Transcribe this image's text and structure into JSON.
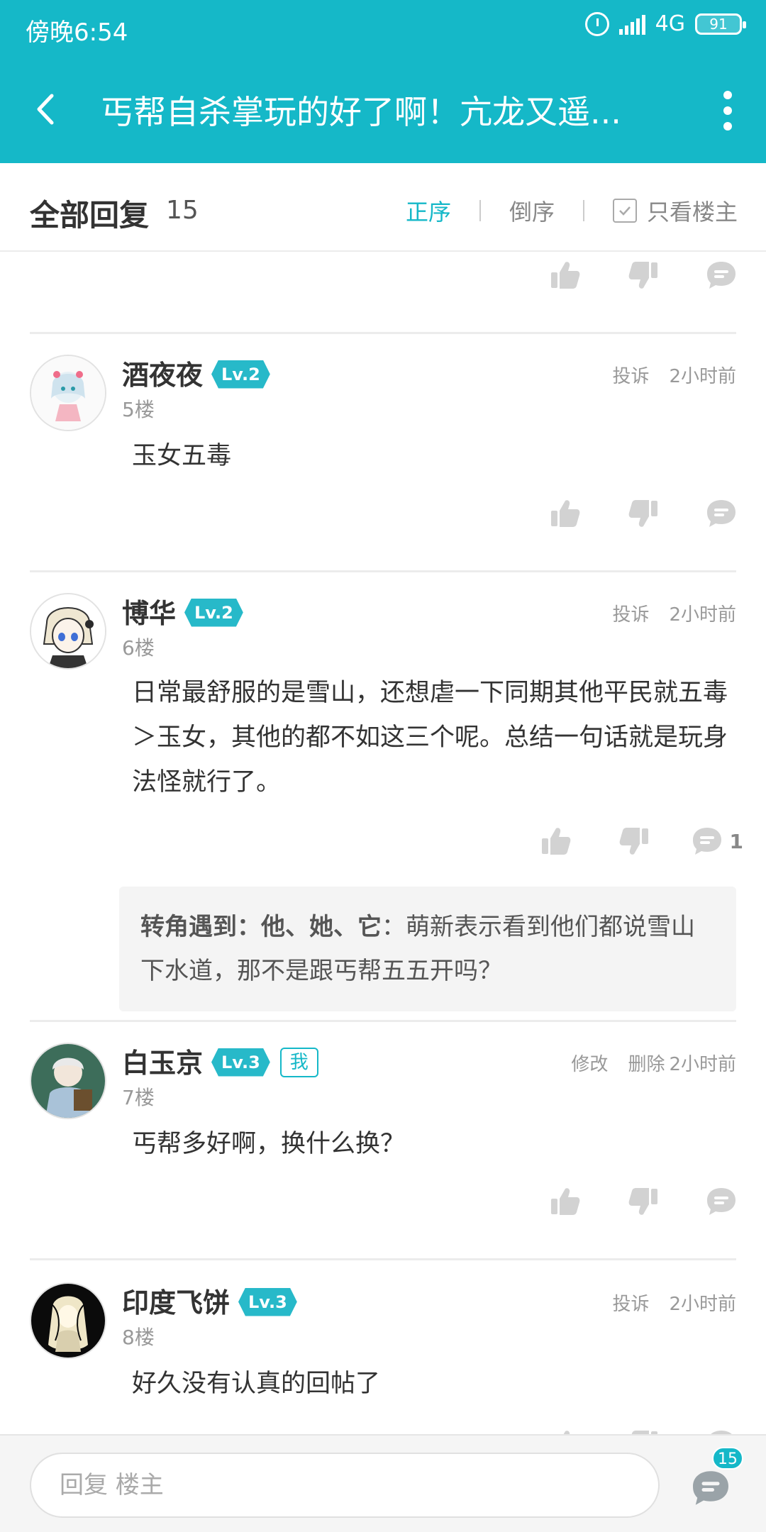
{
  "status_bar": {
    "time": "傍晚6:54",
    "network": "4G",
    "battery": "91"
  },
  "title_bar": {
    "title": "丐帮自杀掌玩的好了啊！亢龙又遥..."
  },
  "replies_header": {
    "title": "全部回复",
    "count": "15",
    "sort_asc": "正序",
    "sort_desc": "倒序",
    "only_op": "只看楼主"
  },
  "posts": [
    {
      "name": "酒夜夜",
      "level": "Lv.2",
      "floor": "5楼",
      "report": "投诉",
      "time": "2小时前",
      "content": "玉女五毒"
    },
    {
      "name": "博华",
      "level": "Lv.2",
      "floor": "6楼",
      "report": "投诉",
      "time": "2小时前",
      "content": "日常最舒服的是雪山，还想虐一下同期其他平民就五毒＞玉女，其他的都不如这三个呢。总结一句话就是玩身法怪就行了。",
      "comment_count": "1",
      "subreply": {
        "author": "转角遇到：他、她、它",
        "text": "萌新表示看到他们都说雪山下水道，那不是跟丐帮五五开吗？"
      }
    },
    {
      "name": "白玉京",
      "level": "Lv.3",
      "me_tag": "我",
      "floor": "7楼",
      "edit": "修改",
      "delete": "删除",
      "time": "2小时前",
      "content": "丐帮多好啊，换什么换？"
    },
    {
      "name": "印度飞饼",
      "level": "Lv.3",
      "floor": "8楼",
      "report": "投诉",
      "time": "2小时前",
      "content": "好久没有认真的回帖了"
    }
  ],
  "bottom_bar": {
    "reply_placeholder": "回复  楼主",
    "reply_badge": "15"
  },
  "colors": {
    "accent": "#15b8c8",
    "level_badge": "#27b9c9",
    "icon_gray": "#d2d2d2"
  },
  "icons": [
    "back-arrow-icon",
    "more-icon",
    "alarm-icon",
    "signal-icon",
    "battery-icon",
    "checkbox-icon",
    "thumbs-up-icon",
    "thumbs-down-icon",
    "comment-icon"
  ]
}
